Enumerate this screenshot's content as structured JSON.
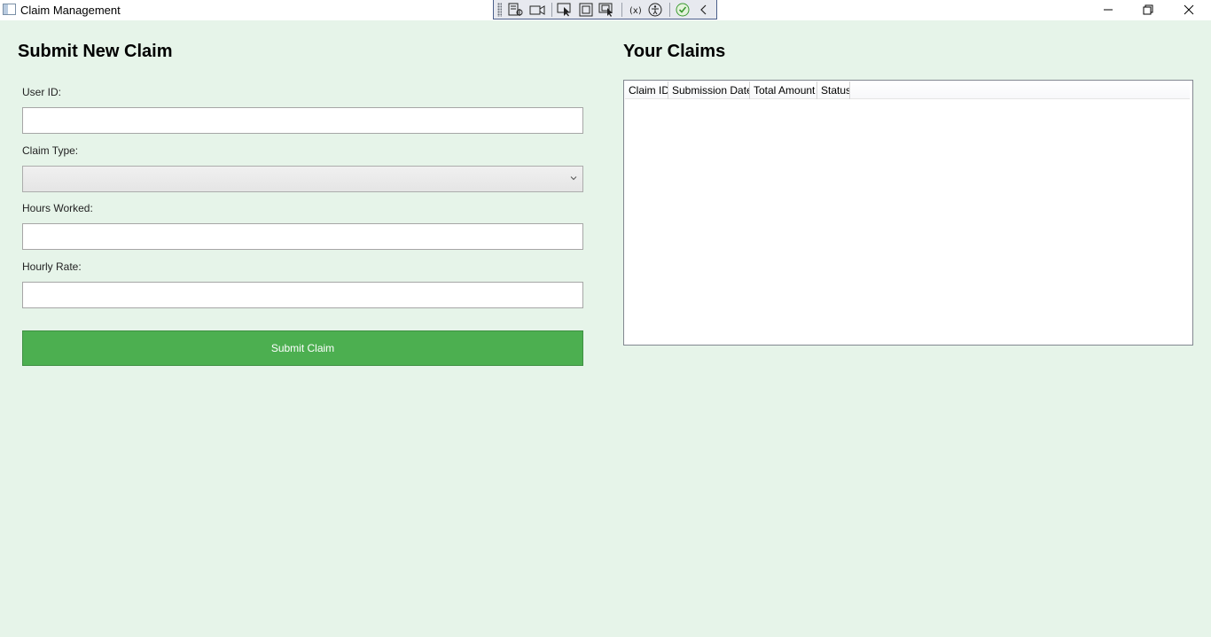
{
  "window": {
    "title": "Claim Management",
    "icon": "app-window-icon",
    "controls": [
      "minimize-icon",
      "restore-icon",
      "close-icon"
    ]
  },
  "debug_toolbar": {
    "tools": [
      "live-visual-tree-icon",
      "record-icon",
      "select-element-icon",
      "display-layout-adorners-icon",
      "track-focused-element-icon",
      "binding-failures-icon",
      "accessibility-icon",
      "accessibility-check-icon",
      "collapse-toolbar-icon"
    ]
  },
  "left": {
    "title": "Submit New Claim",
    "user_id_label": "User ID:",
    "user_id_value": "",
    "claim_type_label": "Claim Type:",
    "claim_type_value": "",
    "hours_label": "Hours Worked:",
    "hours_value": "",
    "rate_label": "Hourly Rate:",
    "rate_value": "",
    "submit_label": "Submit Claim"
  },
  "right": {
    "title": "Your Claims",
    "columns": [
      "Claim ID",
      "Submission Date",
      "Total Amount",
      "Status"
    ],
    "rows": []
  },
  "colors": {
    "background": "#e6f4e9",
    "submit_button": "#4caf50"
  }
}
